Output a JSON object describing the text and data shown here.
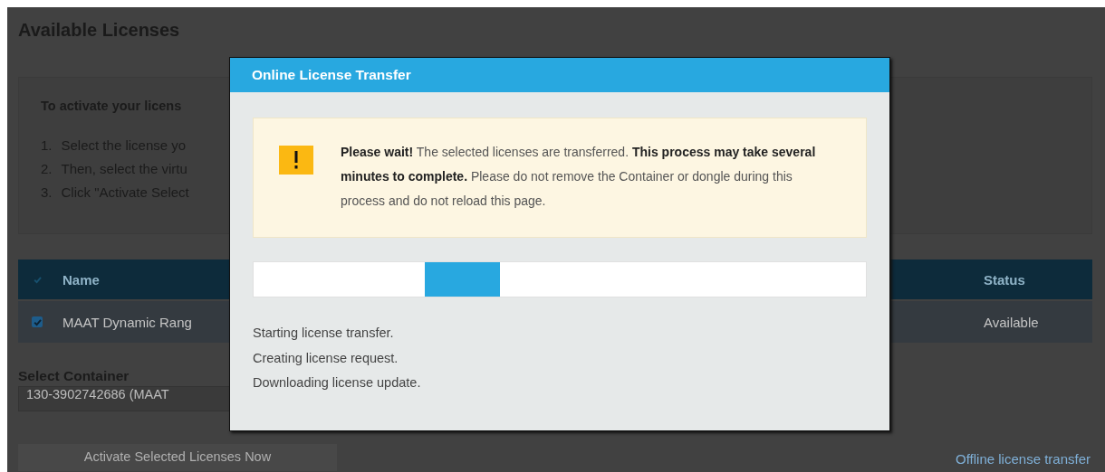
{
  "page": {
    "title": "Available Licenses"
  },
  "instructions": {
    "heading": "To activate your licens",
    "steps": [
      {
        "number": "1.",
        "text": "Select the license yo"
      },
      {
        "number": "2.",
        "text": "Then, select the virtu"
      },
      {
        "number": "3.",
        "text": "Click \"Activate Select"
      }
    ]
  },
  "table": {
    "header_checked": true,
    "columns": [
      {
        "label": "Name"
      },
      {
        "label": "Status"
      }
    ],
    "rows": [
      {
        "checked": true,
        "name": "MAAT Dynamic Rang",
        "status": "Available"
      }
    ]
  },
  "container": {
    "label": "Select Container",
    "value": "130-3902742686 (MAAT"
  },
  "buttons": [
    {
      "label": "Activate Selected Licenses Now",
      "disabled": true
    }
  ],
  "link": "Offline license transfer",
  "dialog": {
    "title": "Online License Transfer",
    "alert": "**Please wait!** The selected licenses are transferred. **This process may take several minutes to complete.** Please do not remove the Container or dongle during this process and do not reload this page.",
    "progress": {
      "indeterminate": true
    },
    "log": [
      "Starting license transfer.",
      "Creating license request.",
      "Downloading license update."
    ]
  }
}
